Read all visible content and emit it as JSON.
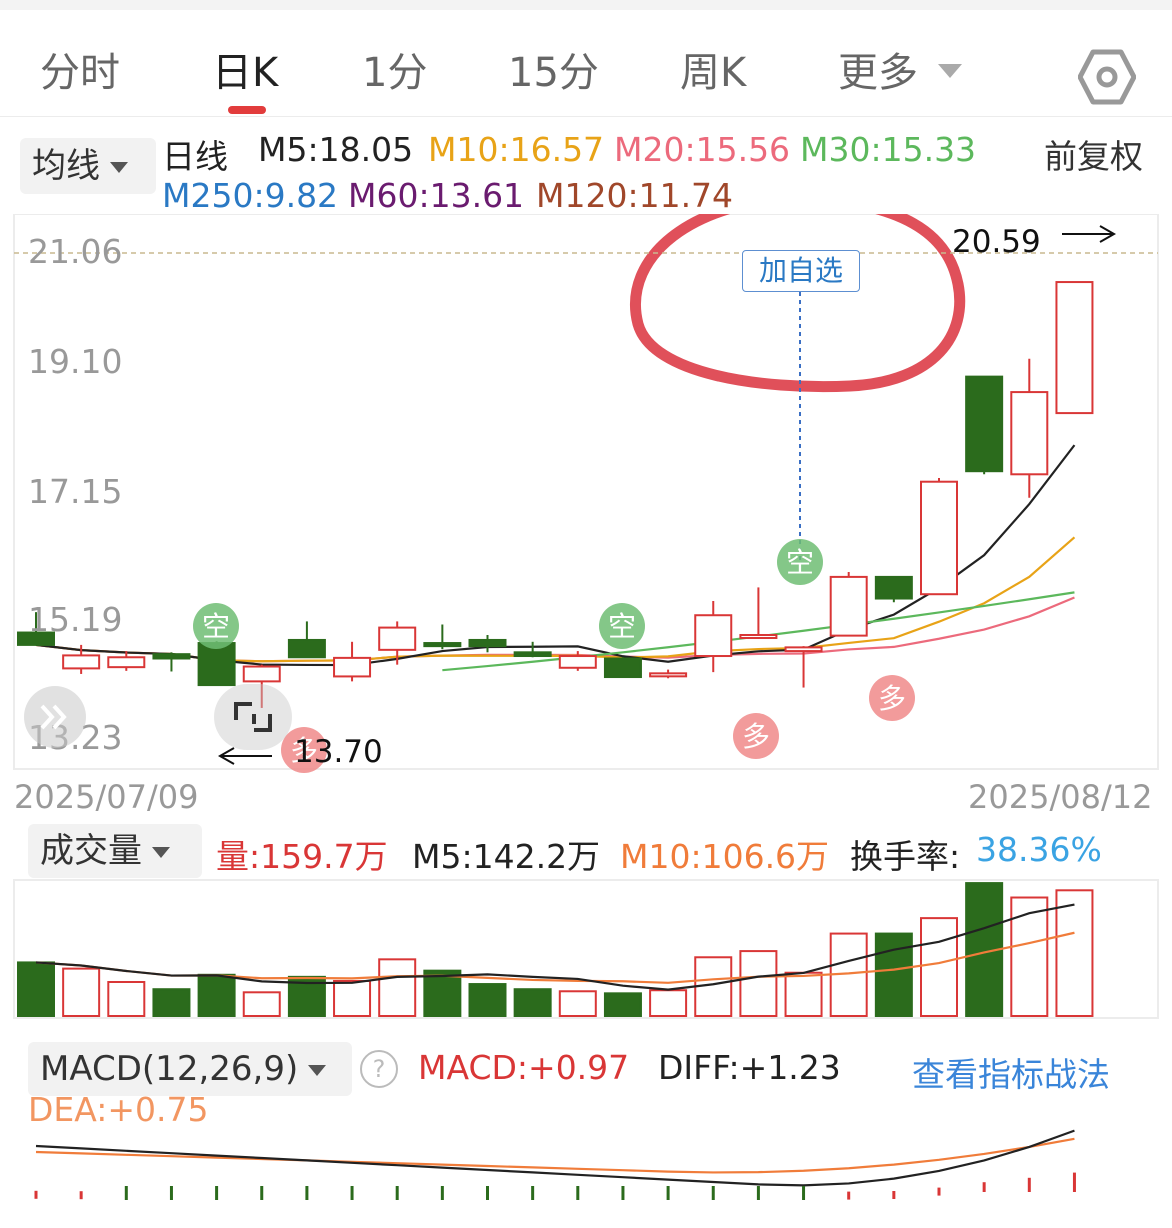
{
  "tabs": [
    {
      "label": "分时",
      "active": false
    },
    {
      "label": "日K",
      "active": true
    },
    {
      "label": "1分",
      "active": false
    },
    {
      "label": "15分",
      "active": false
    },
    {
      "label": "周K",
      "active": false
    },
    {
      "label": "更多",
      "active": false
    }
  ],
  "settings_icon": "hexagon-gear-icon",
  "ma": {
    "dropdown": "均线",
    "period_label": "日线",
    "m5": "M5:18.05",
    "m10": "M10:16.57",
    "m20": "M20:15.56",
    "m30": "M30:15.33",
    "m250": "M250:9.82",
    "m60": "M60:13.61",
    "m120": "M120:11.74",
    "adjust": "前复权",
    "colors": {
      "m5": "#222222",
      "m10": "#e8a317",
      "m20": "#ec6a7c",
      "m30": "#5cb85c",
      "m250": "#2a79c4",
      "m60": "#6a1b6f",
      "m120": "#a0472a"
    }
  },
  "price_axis": [
    "21.06",
    "19.10",
    "17.15",
    "15.19",
    "13.23"
  ],
  "price_markers": {
    "high": "20.59",
    "low": "13.70"
  },
  "add_watchlist": "加自选",
  "signals": {
    "short": "空",
    "long": "多"
  },
  "dates": {
    "start": "2025/07/09",
    "end": "2025/08/12"
  },
  "volume": {
    "dropdown": "成交量",
    "vol": "量:159.7万",
    "m5": "M5:142.2万",
    "m10": "M10:106.6万",
    "turnover_label": "换手率:",
    "turnover_value": "38.36%"
  },
  "macd": {
    "dropdown": "MACD(12,26,9)",
    "macd": "MACD:+0.97",
    "diff": "DIFF:+1.23",
    "dea": "DEA:+0.75",
    "strategy_link": "查看指标战法"
  },
  "chart_data": {
    "type": "candlestick",
    "price_ylim": [
      13.23,
      21.06
    ],
    "candles": [
      {
        "o": 14.92,
        "h": 15.25,
        "l": 14.72,
        "c": 14.72
      },
      {
        "o": 14.34,
        "h": 14.72,
        "l": 14.25,
        "c": 14.55
      },
      {
        "o": 14.36,
        "h": 14.62,
        "l": 14.3,
        "c": 14.52
      },
      {
        "o": 14.57,
        "h": 14.6,
        "l": 14.29,
        "c": 14.5
      },
      {
        "o": 14.75,
        "h": 14.78,
        "l": 14.06,
        "c": 14.07
      },
      {
        "o": 14.13,
        "h": 14.4,
        "l": 13.7,
        "c": 14.37
      },
      {
        "o": 14.8,
        "h": 15.1,
        "l": 14.51,
        "c": 14.52
      },
      {
        "o": 14.21,
        "h": 14.77,
        "l": 14.13,
        "c": 14.51
      },
      {
        "o": 14.64,
        "h": 15.1,
        "l": 14.4,
        "c": 15.0
      },
      {
        "o": 14.75,
        "h": 15.05,
        "l": 14.65,
        "c": 14.7
      },
      {
        "o": 14.8,
        "h": 14.88,
        "l": 14.6,
        "c": 14.7
      },
      {
        "o": 14.6,
        "h": 14.77,
        "l": 14.52,
        "c": 14.54
      },
      {
        "o": 14.35,
        "h": 14.62,
        "l": 14.3,
        "c": 14.54
      },
      {
        "o": 14.5,
        "h": 14.52,
        "l": 14.2,
        "c": 14.2
      },
      {
        "o": 14.22,
        "h": 14.32,
        "l": 14.18,
        "c": 14.26
      },
      {
        "o": 14.54,
        "h": 15.43,
        "l": 14.28,
        "c": 15.2
      },
      {
        "o": 14.88,
        "h": 15.65,
        "l": 14.88,
        "c": 14.88
      },
      {
        "o": 14.62,
        "h": 14.7,
        "l": 14.03,
        "c": 14.68
      },
      {
        "o": 14.87,
        "h": 15.9,
        "l": 14.87,
        "c": 15.82
      },
      {
        "o": 15.82,
        "h": 15.82,
        "l": 15.41,
        "c": 15.47
      },
      {
        "o": 15.54,
        "h": 17.42,
        "l": 15.54,
        "c": 17.36
      },
      {
        "o": 19.06,
        "h": 19.06,
        "l": 17.48,
        "c": 17.53
      },
      {
        "o": 17.48,
        "h": 19.35,
        "l": 17.1,
        "c": 18.81
      },
      {
        "o": 18.47,
        "h": 20.59,
        "l": 18.47,
        "c": 20.59
      }
    ],
    "volume": [
      0.52,
      0.46,
      0.33,
      0.26,
      0.4,
      0.23,
      0.38,
      0.34,
      0.55,
      0.44,
      0.31,
      0.26,
      0.24,
      0.22,
      0.25,
      0.57,
      0.63,
      0.42,
      0.8,
      0.8,
      0.95,
      1.29,
      1.15,
      1.22
    ],
    "macd_hist": [
      0.06,
      0.04,
      -0.08,
      -0.1,
      -0.11,
      -0.12,
      -0.12,
      -0.13,
      -0.12,
      -0.13,
      -0.12,
      -0.11,
      -0.12,
      -0.12,
      -0.12,
      -0.11,
      -0.08,
      -0.07,
      0.02,
      0.05,
      0.22,
      0.49,
      0.71,
      0.97
    ]
  }
}
